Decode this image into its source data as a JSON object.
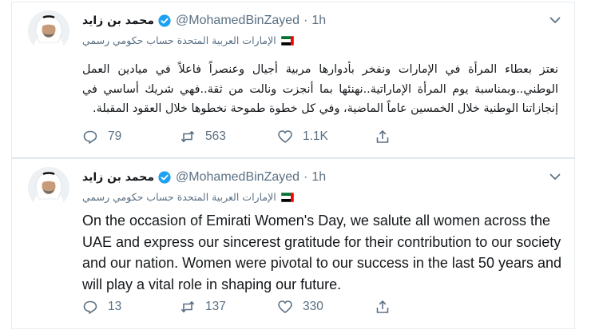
{
  "tweets": [
    {
      "name": "محمد بن زايد",
      "handle": "@MohamedBinZayed",
      "dot": "·",
      "time": "1h",
      "label": "الإمارات العربية المتحدة حساب حكومي رسمي",
      "text": "نعتز بعطاء المرأة في الإمارات ونفخر بأدوارها مربية أجيال وعنصراً فاعلاً في ميادين العمل الوطني..وبمناسبة يوم المرأة الإماراتية..نهنئها بما أنجزت ونالت من ثقة..فهي شريك أساسي في إنجازاتنا الوطنية خلال الخمسين عاماً الماضية، وفي كل خطوة طموحة نخطوها خلال العقود المقبلة.",
      "replies": "79",
      "retweets": "563",
      "likes": "1.1K"
    },
    {
      "name": "محمد بن زايد",
      "handle": "@MohamedBinZayed",
      "dot": "·",
      "time": "1h",
      "label": "الإمارات العربية المتحدة حساب حكومي رسمي",
      "text": "On the occasion of Emirati Women's Day, we salute all women across the UAE and express our sincerest gratitude for their contribution to our society and our nation. Women were pivotal to our success in the last 50 years and will play a vital role in shaping our future.",
      "replies": "13",
      "retweets": "137",
      "likes": "330"
    }
  ],
  "colors": {
    "text": "#14171a",
    "muted": "#5b7083",
    "verified": "#1da1f2",
    "border": "#e6ecf0"
  },
  "icons": [
    "avatar",
    "verified-badge-icon",
    "chevron-down-icon",
    "uae-flag-icon",
    "reply-icon",
    "retweet-icon",
    "like-icon",
    "share-icon"
  ]
}
